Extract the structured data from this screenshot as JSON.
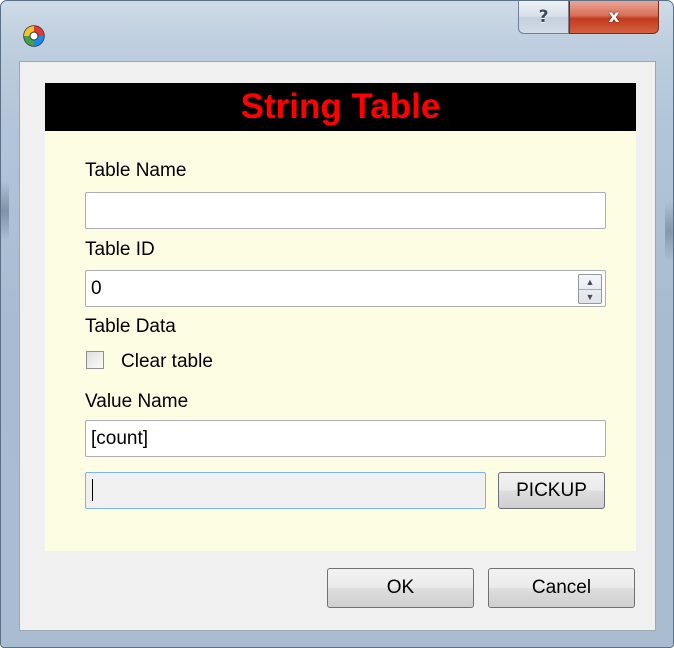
{
  "window": {
    "help_label": "?",
    "close_label": "x"
  },
  "banner": {
    "title": "String Table",
    "color": "#ff0000",
    "background": "#000000"
  },
  "form": {
    "table_name_label": "Table Name",
    "table_name_value": "",
    "table_id_label": "Table ID",
    "table_id_value": "0",
    "table_data_label": "Table Data",
    "clear_table_label": "Clear table",
    "clear_table_checked": false,
    "value_name_label": "Value Name",
    "value_name_value": "[count]",
    "pickup_value": "",
    "pickup_label": "PICKUP"
  },
  "footer": {
    "ok_label": "OK",
    "cancel_label": "Cancel"
  },
  "colors": {
    "panel_background": "#fdfde4",
    "close_button": "#c23b1f"
  },
  "icons": {
    "app": "app-icon",
    "spin_up": "spin-up-icon",
    "spin_down": "spin-down-icon"
  }
}
